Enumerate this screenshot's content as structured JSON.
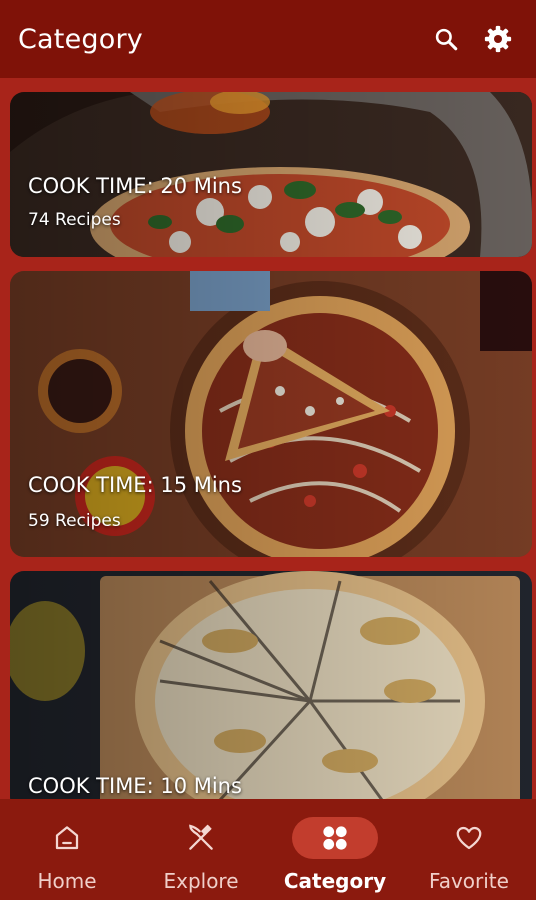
{
  "appbar": {
    "title": "Category",
    "search_icon": "search-icon",
    "settings_icon": "gear-icon"
  },
  "categories": [
    {
      "cook_time": "COOK TIME: 20 Mins",
      "recipes": "74 Recipes"
    },
    {
      "cook_time": "COOK TIME: 15 Mins",
      "recipes": "59 Recipes"
    },
    {
      "cook_time": "COOK TIME: 10 Mins"
    }
  ],
  "nav": {
    "items": [
      {
        "label": "Home",
        "icon": "home-icon"
      },
      {
        "label": "Explore",
        "icon": "fork-knife-icon"
      },
      {
        "label": "Category",
        "icon": "grid-icon"
      },
      {
        "label": "Favorite",
        "icon": "heart-icon"
      }
    ],
    "active": "Category"
  },
  "colors": {
    "appbar": "#7f1208",
    "background": "#a8241a",
    "navbar": "#8b1a0e",
    "active_pill": "#c23d2d"
  }
}
